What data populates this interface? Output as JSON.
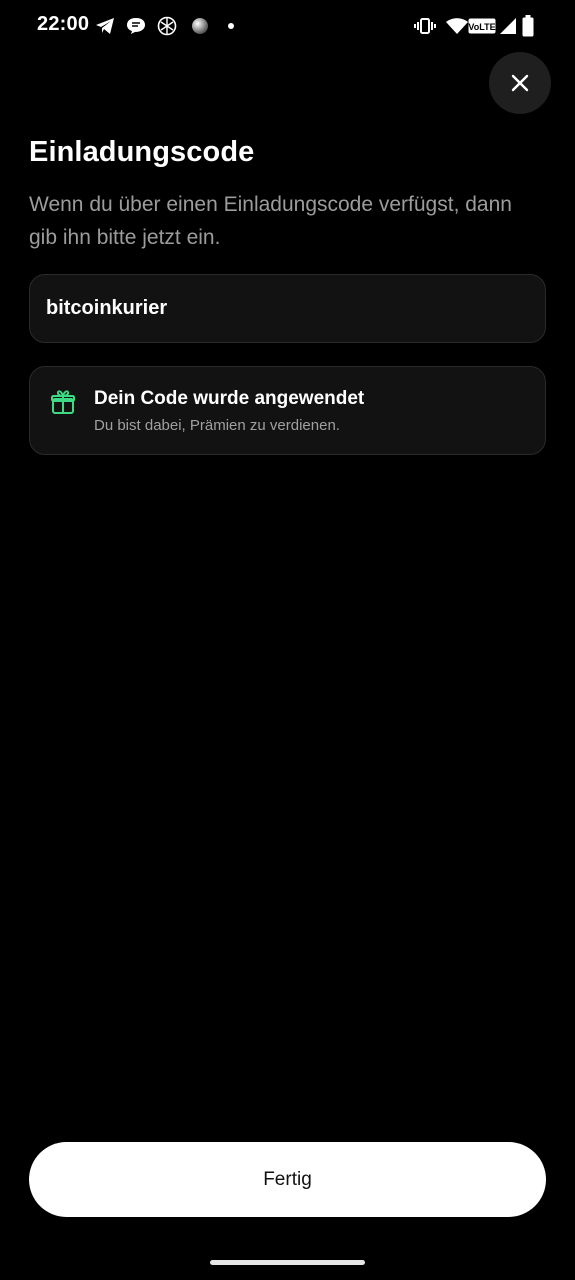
{
  "status_bar": {
    "time": "22:00",
    "left_icons": [
      "telegram-icon",
      "chat-bubble-icon",
      "crypto-app-icon",
      "sphere-icon",
      "notification-dot-icon"
    ],
    "right_icons": [
      "vibrate-icon",
      "wifi-icon",
      "volte-icon",
      "signal-icon",
      "battery-icon"
    ],
    "volte_label": "VoLTE"
  },
  "header": {
    "title": "Einladungscode",
    "subtitle": "Wenn du über einen Einladungscode verfügst, dann gib ihn bitte jetzt ein."
  },
  "code_input": {
    "value": "bitcoinkurier"
  },
  "status_card": {
    "icon": "gift-icon",
    "title": "Dein Code wurde angewendet",
    "subtitle": "Du bist dabei, Prämien zu verdienen."
  },
  "footer": {
    "done_label": "Fertig"
  },
  "colors": {
    "background": "#000000",
    "accent_green": "#3ddc84",
    "card_background": "#121212",
    "button_background": "#ffffff"
  }
}
